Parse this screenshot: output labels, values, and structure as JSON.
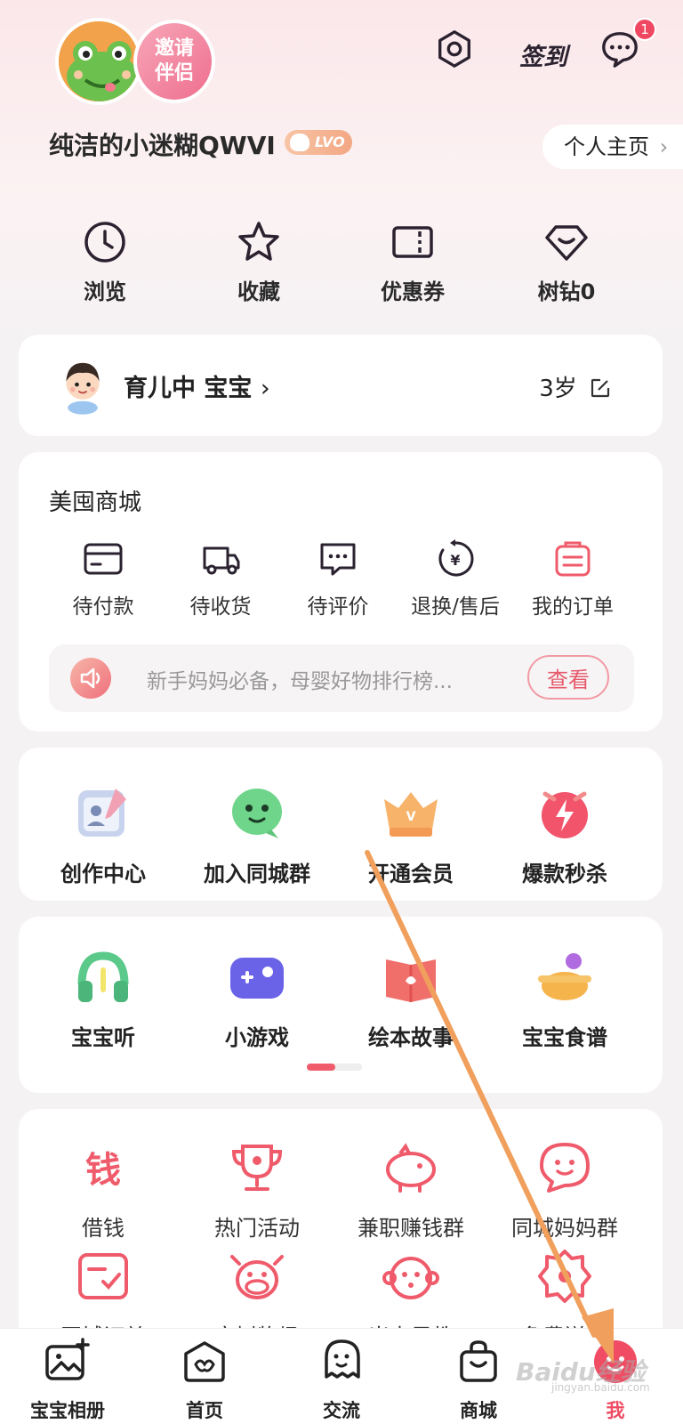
{
  "header": {
    "invite_line1": "邀请",
    "invite_line2": "伴侣",
    "signin_label": "签到",
    "message_badge_count": "1",
    "username": "纯洁的小迷糊QWVI",
    "level": "LVO",
    "homepage_label": "个人主页"
  },
  "quick_actions": [
    {
      "label": "浏览",
      "icon": "clock-icon"
    },
    {
      "label": "收藏",
      "icon": "star-icon"
    },
    {
      "label": "优惠券",
      "icon": "coupon-icon"
    },
    {
      "label": "树钻0",
      "icon": "diamond-icon"
    }
  ],
  "baby_card": {
    "status": "育儿中 宝宝",
    "age": "3岁"
  },
  "mall": {
    "title": "美囤商城",
    "orders": [
      {
        "label": "待付款",
        "icon": "card-icon"
      },
      {
        "label": "待收货",
        "icon": "truck-icon"
      },
      {
        "label": "待评价",
        "icon": "comment-icon"
      },
      {
        "label": "退换/售后",
        "icon": "refund-icon"
      },
      {
        "label": "我的订单",
        "icon": "order-list-icon"
      }
    ],
    "notice_text": "新手妈妈必备，母婴好物排行榜...",
    "notice_button": "查看"
  },
  "features_row1": [
    {
      "label": "创作中心",
      "icon": "creation-icon"
    },
    {
      "label": "加入同城群",
      "icon": "chat-bubble-icon"
    },
    {
      "label": "开通会员",
      "icon": "crown-icon"
    },
    {
      "label": "爆款秒杀",
      "icon": "flash-clock-icon"
    }
  ],
  "features_row2": [
    {
      "label": "宝宝听",
      "icon": "headphones-icon"
    },
    {
      "label": "小游戏",
      "icon": "gamepad-icon"
    },
    {
      "label": "绘本故事",
      "icon": "picture-book-icon"
    },
    {
      "label": "宝宝食谱",
      "icon": "pot-icon"
    }
  ],
  "services": [
    {
      "label": "借钱",
      "icon": "money-icon"
    },
    {
      "label": "热门活动",
      "icon": "trophy-icon"
    },
    {
      "label": "兼职赚钱群",
      "icon": "piggy-bank-icon"
    },
    {
      "label": "同城妈妈群",
      "icon": "chat-face-icon"
    },
    {
      "label": "同城订单",
      "icon": "order-check-icon"
    },
    {
      "label": "宝树牧场",
      "icon": "cow-icon"
    },
    {
      "label": "米卡早教",
      "icon": "monkey-icon"
    },
    {
      "label": "免费送礼",
      "icon": "gift-badge-icon"
    }
  ],
  "bottom_nav": [
    {
      "label": "宝宝相册",
      "icon": "album-icon"
    },
    {
      "label": "首页",
      "icon": "home-icon"
    },
    {
      "label": "交流",
      "icon": "community-icon"
    },
    {
      "label": "商城",
      "icon": "shopping-bag-icon"
    },
    {
      "label": "我",
      "icon": "me-icon",
      "active": true
    }
  ],
  "watermark": "Baidu经验",
  "watermark_sub": "jingyan.baidu.com",
  "colors": {
    "accent": "#ef4c63",
    "arrow": "#f0a05c"
  }
}
